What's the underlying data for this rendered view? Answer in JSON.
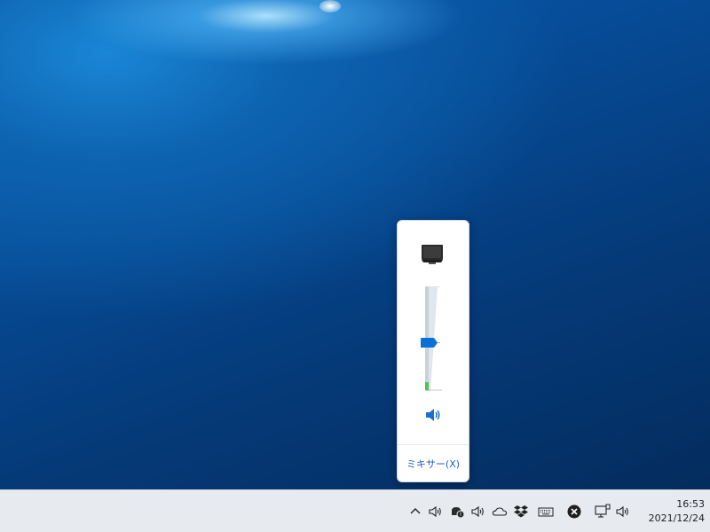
{
  "volume_flyout": {
    "device_icon": "monitor-speaker-icon",
    "volume_level": 0.5,
    "peak_level": 0.08,
    "speaker_icon": "speaker-icon",
    "mixer_label": "ミキサー(X)"
  },
  "taskbar": {
    "tray_icons": [
      "chevron-up-icon",
      "speaker-icon",
      "windows-security-icon",
      "speaker-icon",
      "onedrive-cloud-icon",
      "dropbox-icon",
      "keyboard-icon",
      "close-circle-icon",
      "network-icon",
      "speaker-icon"
    ],
    "clock": {
      "time": "16:53",
      "date": "2021/12/24"
    }
  },
  "colors": {
    "accent": "#0a6fd6",
    "peak_meter": "#4fc24f",
    "link": "#1d5fbf"
  }
}
